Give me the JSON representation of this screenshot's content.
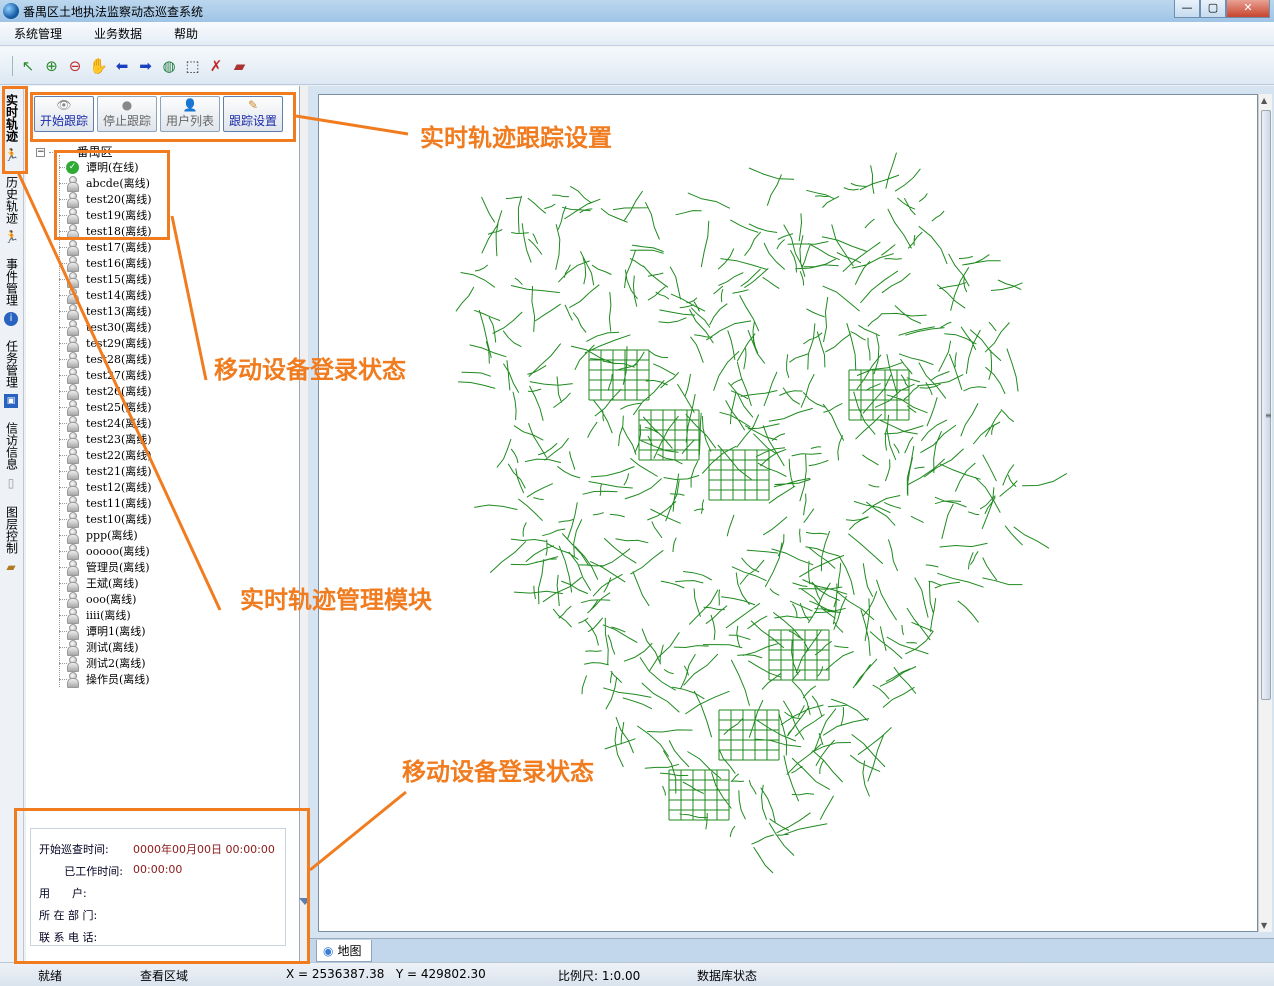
{
  "window": {
    "title": "番禺区土地执法监察动态巡查系统",
    "minimize": "—",
    "maximize": "▢",
    "close": "✕"
  },
  "menu": [
    "系统管理",
    "业务数据",
    "帮助"
  ],
  "toolbar": [
    {
      "icon": "select-arrow-icon",
      "glyph": "↖"
    },
    {
      "icon": "zoom-in-icon",
      "glyph": "⊕"
    },
    {
      "icon": "zoom-out-icon",
      "glyph": "⊖"
    },
    {
      "icon": "pan-hand-icon",
      "glyph": "✋"
    },
    {
      "icon": "back-arrow-icon",
      "glyph": "⬅"
    },
    {
      "icon": "forward-arrow-icon",
      "glyph": "➡"
    },
    {
      "icon": "globe-icon",
      "glyph": "◍"
    },
    {
      "icon": "full-extent-icon",
      "glyph": "⬚"
    },
    {
      "icon": "clear-selection-icon",
      "glyph": "✗"
    },
    {
      "icon": "eraser-icon",
      "glyph": "▰"
    }
  ],
  "side_tabs": [
    {
      "label": "实时轨迹",
      "icon": "runner-icon",
      "active": true
    },
    {
      "label": "历史轨迹",
      "icon": "runner-icon"
    },
    {
      "label": "事件管理",
      "icon": "info-icon"
    },
    {
      "label": "任务管理",
      "icon": "task-icon"
    },
    {
      "label": "信访信息",
      "icon": "document-icon"
    },
    {
      "label": "图层控制",
      "icon": "layers-icon"
    }
  ],
  "track_buttons": [
    {
      "label": "开始跟踪",
      "icon": "eye-icon",
      "enabled": true
    },
    {
      "label": "停止跟踪",
      "icon": "stop-icon",
      "enabled": false
    },
    {
      "label": "用户列表",
      "icon": "user-icon",
      "enabled": false
    },
    {
      "label": "跟踪设置",
      "icon": "settings-icon",
      "enabled": true
    }
  ],
  "tree": {
    "root": "番禺区",
    "users": [
      {
        "name": "谭明",
        "status": "(在线)",
        "online": true
      },
      {
        "name": "abcde",
        "status": "(离线)"
      },
      {
        "name": "test20",
        "status": "(离线)"
      },
      {
        "name": "test19",
        "status": "(离线)"
      },
      {
        "name": "test18",
        "status": "(离线)"
      },
      {
        "name": "test17",
        "status": "(离线)"
      },
      {
        "name": "test16",
        "status": "(离线)"
      },
      {
        "name": "test15",
        "status": "(离线)"
      },
      {
        "name": "test14",
        "status": "(离线)"
      },
      {
        "name": "test13",
        "status": "(离线)"
      },
      {
        "name": "test30",
        "status": "(离线)"
      },
      {
        "name": "test29",
        "status": "(离线)"
      },
      {
        "name": "test28",
        "status": "(离线)"
      },
      {
        "name": "test27",
        "status": "(离线)"
      },
      {
        "name": "test26",
        "status": "(离线)"
      },
      {
        "name": "test25",
        "status": "(离线)"
      },
      {
        "name": "test24",
        "status": "(离线)"
      },
      {
        "name": "test23",
        "status": "(离线)"
      },
      {
        "name": "test22",
        "status": "(离线)"
      },
      {
        "name": "test21",
        "status": "(离线)"
      },
      {
        "name": "test12",
        "status": "(离线)"
      },
      {
        "name": "test11",
        "status": "(离线)"
      },
      {
        "name": "test10",
        "status": "(离线)"
      },
      {
        "name": "ppp",
        "status": "(离线)"
      },
      {
        "name": "ooooo",
        "status": "(离线)"
      },
      {
        "name": "管理员",
        "status": "(离线)"
      },
      {
        "name": "王斌",
        "status": "(离线)"
      },
      {
        "name": "ooo",
        "status": "(离线)"
      },
      {
        "name": "iiii",
        "status": "(离线)"
      },
      {
        "name": "谭明1",
        "status": "(离线)"
      },
      {
        "name": "测试",
        "status": "(离线)"
      },
      {
        "name": "测试2",
        "status": "(离线)"
      },
      {
        "name": "操作员",
        "status": "(离线)"
      }
    ]
  },
  "info": [
    {
      "label": "开始巡查时间:",
      "value": "0000年00月00日 00:00:00"
    },
    {
      "label": "已工作时间:",
      "value": "00:00:00"
    },
    {
      "label": "用　　户:",
      "value": ""
    },
    {
      "label": "所 在 部 门:",
      "value": ""
    },
    {
      "label": "联 系 电 话:",
      "value": ""
    }
  ],
  "map_tab": {
    "label": "地图",
    "icon": "map-icon"
  },
  "status": {
    "ready": "就绪",
    "view_area": "查看区域",
    "coords": "X = 2536387.38   Y = 429802.30",
    "scale": "比例尺: 1:0.00",
    "db": "数据库状态"
  },
  "callouts": {
    "tracking_settings": "实时轨迹跟踪设置",
    "login_status_1": "移动设备登录状态",
    "module": "实时轨迹管理模块",
    "login_status_2": "移动设备登录状态"
  },
  "colors": {
    "accent": "#f07c1f",
    "road": "#1f8a1f",
    "online": "#2eaa35"
  }
}
